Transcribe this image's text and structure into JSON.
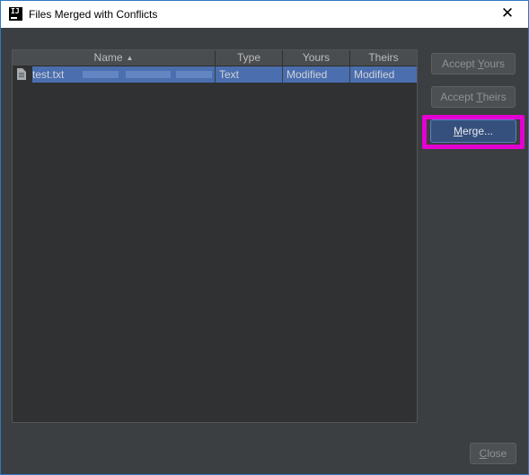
{
  "window": {
    "title": "Files Merged with Conflicts",
    "app_icon_text": "IJ",
    "close_glyph": "✕"
  },
  "table": {
    "columns": [
      {
        "label": "Name",
        "sorted": "ascending"
      },
      {
        "label": "Type"
      },
      {
        "label": "Yours"
      },
      {
        "label": "Theirs"
      }
    ],
    "sort_glyph": "▲",
    "rows": [
      {
        "name": "test.txt",
        "type": "Text",
        "yours": "Modified",
        "theirs": "Modified",
        "icon": "text-file-icon",
        "selected": true
      }
    ]
  },
  "buttons": {
    "accept_yours_prefix": "Accept ",
    "accept_yours_mnemonic": "Y",
    "accept_yours_suffix": "ours",
    "accept_theirs_prefix": "Accept ",
    "accept_theirs_mnemonic": "T",
    "accept_theirs_suffix": "heirs",
    "merge_mnemonic": "M",
    "merge_suffix": "erge...",
    "close_mnemonic": "C",
    "close_suffix": "lose"
  },
  "colors": {
    "background": "#3c3f41",
    "selection": "#4b6eaf",
    "highlight": "#e400d2"
  }
}
